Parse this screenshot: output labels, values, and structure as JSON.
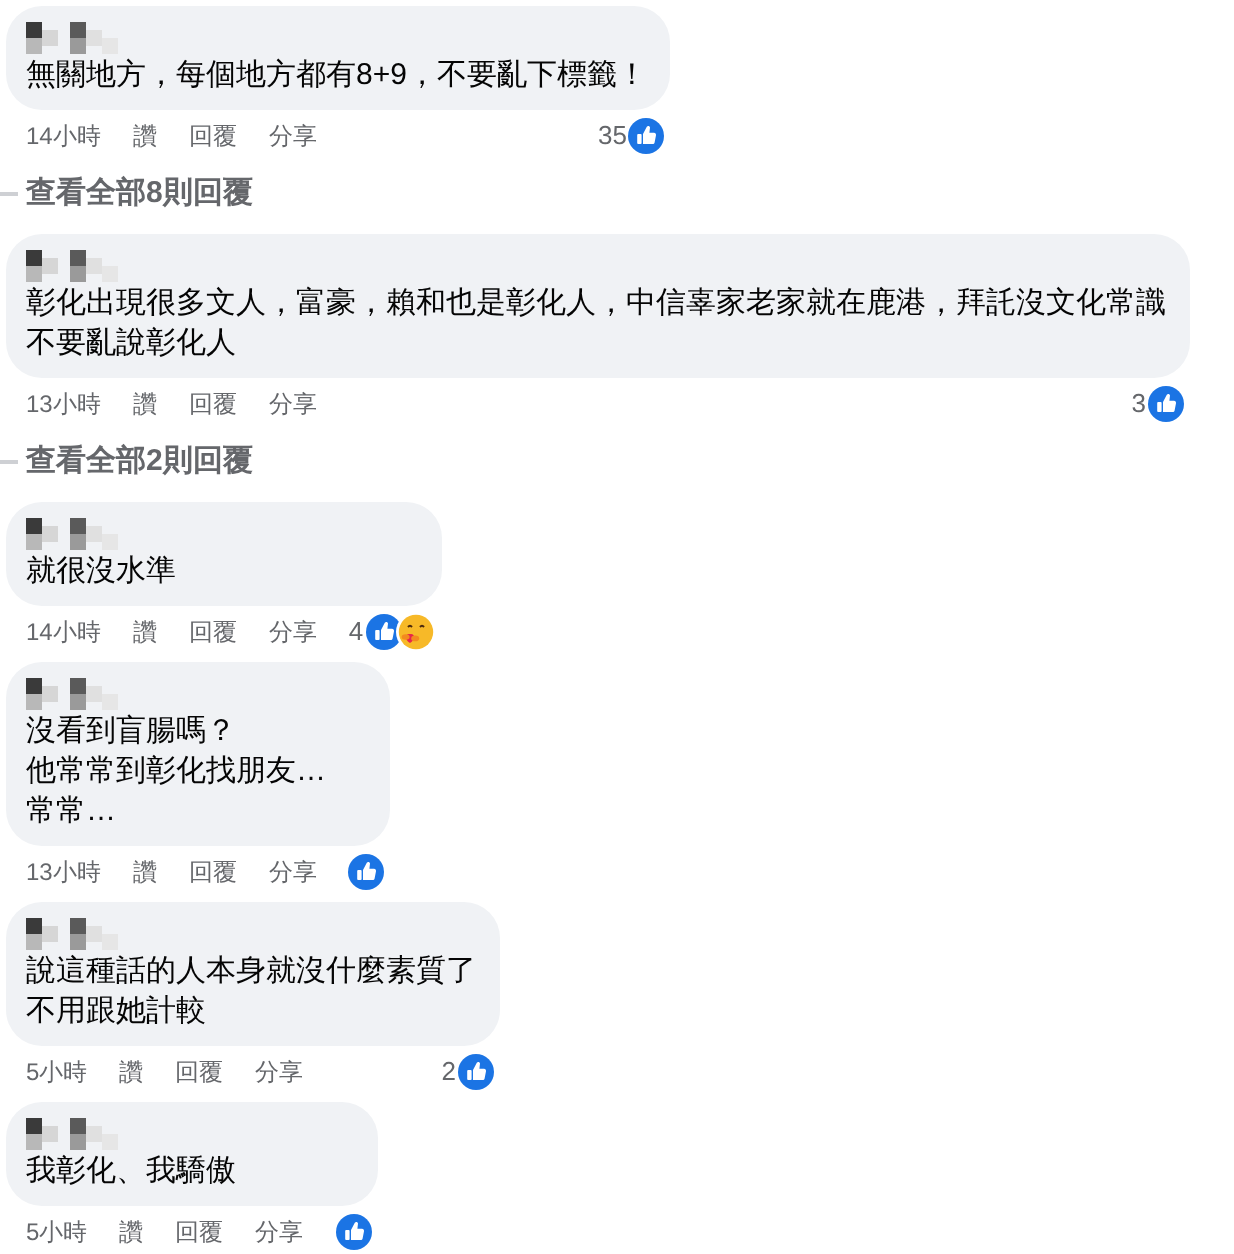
{
  "comments": [
    {
      "lines": [
        "無關地方，每個地方都有8+9，不要亂下標籤！"
      ],
      "time": "14小時",
      "actions": {
        "like": "讚",
        "reply": "回覆",
        "share": "分享"
      },
      "reactions": {
        "count": "35",
        "icons": [
          {
            "kind": "like"
          }
        ]
      },
      "view_replies": "查看全部8則回覆"
    },
    {
      "lines": [
        "彰化出現很多文人，富豪，賴和也是彰化人，中信辜家老家就在鹿港，拜託沒文化常識",
        "不要亂說彰化人"
      ],
      "time": "13小時",
      "actions": {
        "like": "讚",
        "reply": "回覆",
        "share": "分享"
      },
      "reactions": {
        "count": "3",
        "icons": [
          {
            "kind": "like"
          }
        ]
      },
      "view_replies": "查看全部2則回覆"
    },
    {
      "lines": [
        "就很沒水準"
      ],
      "time": "14小時",
      "actions": {
        "like": "讚",
        "reply": "回覆",
        "share": "分享"
      },
      "reactions": {
        "count": "4",
        "icons": [
          {
            "kind": "like"
          },
          {
            "kind": "care"
          }
        ]
      }
    },
    {
      "lines": [
        "沒看到盲腸嗎？",
        "他常常到彰化找朋友…",
        "常常…"
      ],
      "time": "13小時",
      "actions": {
        "like": "讚",
        "reply": "回覆",
        "share": "分享"
      },
      "reactions": {
        "icons": [
          {
            "kind": "like"
          }
        ]
      }
    },
    {
      "lines": [
        "說這種話的人本身就沒什麼素質了",
        "不用跟她計較"
      ],
      "time": "5小時",
      "actions": {
        "like": "讚",
        "reply": "回覆",
        "share": "分享"
      },
      "reactions": {
        "count": "2",
        "icons": [
          {
            "kind": "like"
          }
        ]
      }
    },
    {
      "lines": [
        "我彰化、我驕傲"
      ],
      "time": "5小時",
      "actions": {
        "like": "讚",
        "reply": "回覆",
        "share": "分享"
      },
      "reactions": {
        "icons": [
          {
            "kind": "like"
          }
        ]
      }
    }
  ]
}
